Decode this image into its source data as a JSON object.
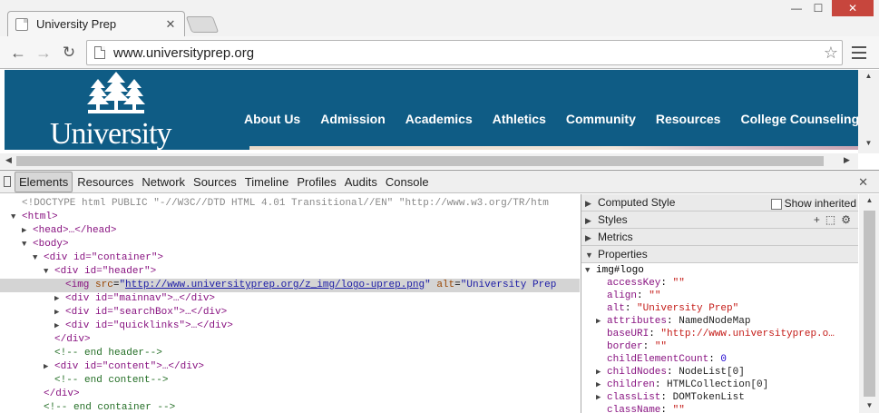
{
  "browser": {
    "tab_title": "University Prep",
    "url": "www.universityprep.org"
  },
  "site": {
    "logo_text": "University",
    "nav": [
      "About Us",
      "Admission",
      "Academics",
      "Athletics",
      "Community",
      "Resources",
      "College Counseling"
    ]
  },
  "devtools": {
    "tabs": [
      "Elements",
      "Resources",
      "Network",
      "Sources",
      "Timeline",
      "Profiles",
      "Audits",
      "Console"
    ],
    "active_tab": "Elements",
    "elements": {
      "doctype": "<!DOCTYPE html PUBLIC \"-//W3C//DTD HTML 4.01 Transitional//EN\" \"http://www.w3.org/TR/htm",
      "html_open": "<html>",
      "head": "<head>…</head>",
      "body_open": "<body>",
      "container_open": "<div id=\"container\">",
      "header_open": "<div id=\"header\">",
      "img_src": "http://www.universityprep.org/z_img/logo-uprep.png",
      "img_alt": "University Prep",
      "mainnav": "<div id=\"mainnav\">…</div>",
      "searchbox": "<div id=\"searchBox\">…</div>",
      "quicklinks": "<div id=\"quicklinks\">…</div>",
      "div_close": "</div>",
      "end_header_comment": "<!-- end header-->",
      "content": "<div id=\"content\">…</div>",
      "end_content_comment": "<!-- end content-->",
      "end_container_comment": "<!-- end container -->"
    },
    "sidebar": {
      "computed_style": "Computed Style",
      "show_inherited": "Show inherited",
      "styles": "Styles",
      "metrics": "Metrics",
      "properties": "Properties",
      "object_name": "img#logo",
      "props": [
        {
          "name": "accessKey",
          "value": "\"\"",
          "kind": "str",
          "expandable": false
        },
        {
          "name": "align",
          "value": "\"\"",
          "kind": "str",
          "expandable": false
        },
        {
          "name": "alt",
          "value": "\"University Prep\"",
          "kind": "str",
          "expandable": false
        },
        {
          "name": "attributes",
          "value": "NamedNodeMap",
          "kind": "obj",
          "expandable": true
        },
        {
          "name": "baseURI",
          "value": "\"http://www.universityprep.o…",
          "kind": "str",
          "expandable": false
        },
        {
          "name": "border",
          "value": "\"\"",
          "kind": "str",
          "expandable": false
        },
        {
          "name": "childElementCount",
          "value": "0",
          "kind": "num",
          "expandable": false
        },
        {
          "name": "childNodes",
          "value": "NodeList[0]",
          "kind": "obj",
          "expandable": true
        },
        {
          "name": "children",
          "value": "HTMLCollection[0]",
          "kind": "obj",
          "expandable": true
        },
        {
          "name": "classList",
          "value": "DOMTokenList",
          "kind": "obj",
          "expandable": true
        },
        {
          "name": "className",
          "value": "\"\"",
          "kind": "str",
          "expandable": false
        }
      ]
    }
  }
}
